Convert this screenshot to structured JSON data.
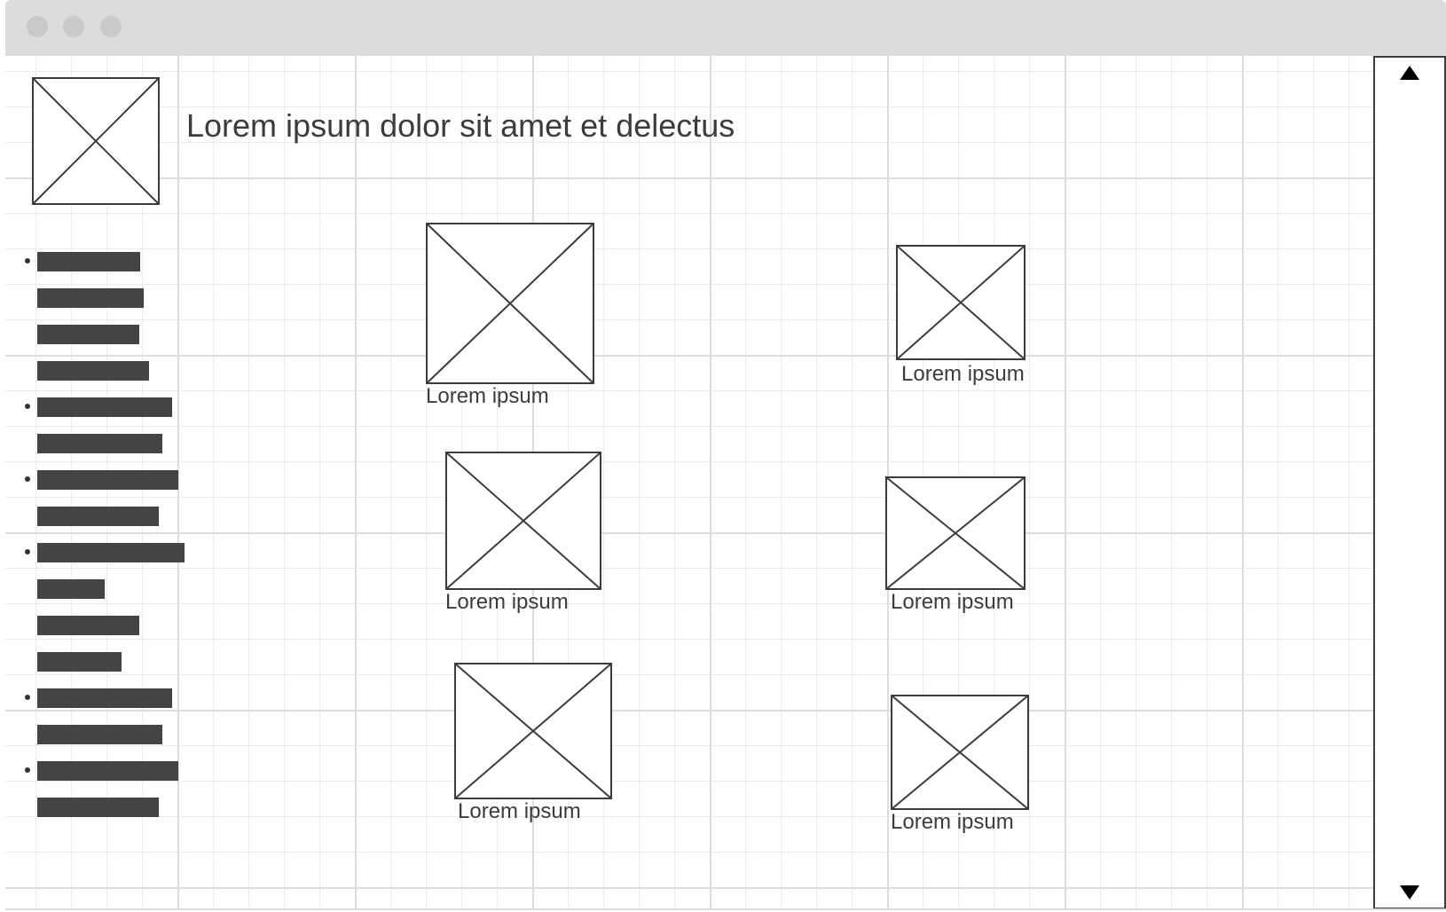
{
  "header": {
    "title": "Lorem ipsum dolor sit amet et delectus"
  },
  "nav": {
    "items": [
      {
        "bullet": true
      },
      {
        "bullet": false
      },
      {
        "bullet": false
      },
      {
        "bullet": false
      },
      {
        "bullet": true
      },
      {
        "bullet": false
      },
      {
        "bullet": true
      },
      {
        "bullet": false
      },
      {
        "bullet": true
      },
      {
        "bullet": false
      },
      {
        "bullet": false
      },
      {
        "bullet": false
      },
      {
        "bullet": true
      },
      {
        "bullet": false
      },
      {
        "bullet": true
      },
      {
        "bullet": false
      }
    ]
  },
  "gallery": {
    "captions": [
      "Lorem ipsum",
      "Lorem ipsum",
      "Lorem ipsum",
      "Lorem ipsum",
      "Lorem ipsum",
      "Lorem ipsum"
    ]
  },
  "icons": {
    "placeholder": "image-placeholder-icon",
    "scroll_up": "triangle-up-icon",
    "scroll_down": "triangle-down-icon"
  },
  "colors": {
    "stroke": "#3c3c3c",
    "bar": "#444444",
    "titlebar": "#dcdcdc"
  }
}
